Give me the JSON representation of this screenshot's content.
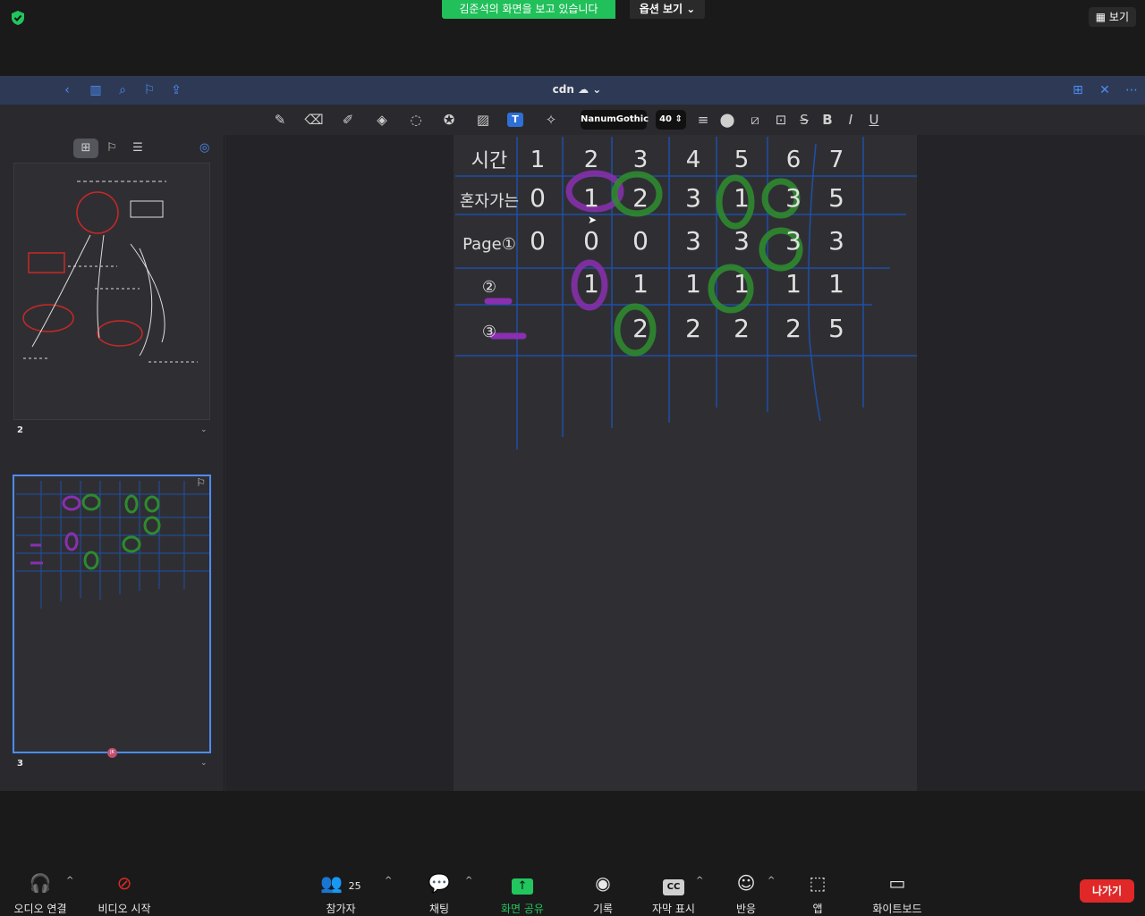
{
  "top_bar": {
    "share_banner": "김준석의 화면을 보고 있습니다",
    "options_label": "옵션 보기 ⌄",
    "view_label": "보기"
  },
  "document": {
    "title": "cdn",
    "font_name": "NanumGothic",
    "font_size": "40"
  },
  "sidebar": {
    "pages": [
      {
        "number": "2"
      },
      {
        "number": "3"
      }
    ],
    "avatar_initials": "JK"
  },
  "note": {
    "row_headers": [
      "시간",
      "혼자가는",
      "Page①",
      "②",
      "③"
    ],
    "columns": [
      "1",
      "2",
      "3",
      "4",
      "5",
      "6",
      "7"
    ],
    "rows": [
      [
        "0",
        "1",
        "2",
        "3",
        "1",
        "3",
        "5"
      ],
      [
        "0",
        "0",
        "0",
        "3",
        "3",
        "3",
        "3"
      ],
      [
        "",
        "1",
        "1",
        "1",
        "1",
        "1",
        "1"
      ],
      [
        "",
        "",
        "2",
        "2",
        "2",
        "2",
        "5"
      ]
    ]
  },
  "controls": {
    "audio": "오디오 연결",
    "video": "비디오 시작",
    "participants": "참가자",
    "participants_count": "25",
    "chat": "채팅",
    "share": "화면 공유",
    "record": "기록",
    "captions": "자막 표시",
    "reactions": "반응",
    "apps": "앱",
    "whiteboard": "화이트보드",
    "leave": "나가기"
  },
  "colors": {
    "share_green": "#21c05a",
    "accent_blue": "#4d8cf5",
    "leave_red": "#e02828",
    "ink_blue": "#1f4fa8",
    "highlight_purple": "#8a2fb0",
    "highlight_green": "#2f8a2f"
  }
}
